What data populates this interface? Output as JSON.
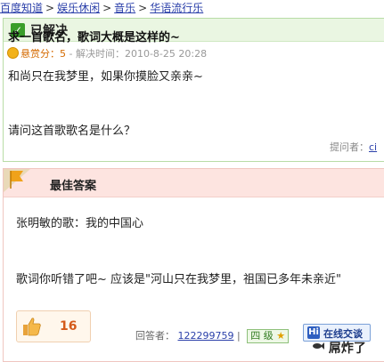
{
  "breadcrumb": {
    "items": [
      "百度知道",
      "娱乐休闲",
      "音乐",
      "华语流行乐"
    ],
    "separator": ">"
  },
  "question": {
    "status": "已解决",
    "title": "求一首歌名，歌词大概是这样的~",
    "bounty_label": "悬赏分：5",
    "resolve_label": "- 解决时间：2010-8-25 20:28",
    "body_line1": "和尚只在我梦里，如果你摸脸又亲亲~",
    "body_line2": "请问这首歌歌名是什么？",
    "asker_label": "提问者：",
    "asker_name": "ci"
  },
  "answer": {
    "header": "最佳答案",
    "line1": "张明敏的歌：我的中国心",
    "line2": "歌词你听错了吧~  应该是\"河山只在我梦里，祖国已多年未亲近\"",
    "likes": "16",
    "answerer_label": "回答者：",
    "answerer_name": "122299759",
    "level_sep": "|",
    "level": "四 级",
    "chat_icon": "Hi",
    "chat_label": "在线交谈"
  },
  "watermark": "屌炸了",
  "colors": {
    "link": "#2a3fa9",
    "question_border": "#b8dca6",
    "answer_header_bg": "#fde4e0",
    "accent_orange": "#d45a1a"
  },
  "icons": {
    "status": "checkmark-icon",
    "bounty": "coin-icon",
    "best": "flag-icon",
    "like": "thumbs-up-icon",
    "chat": "baidu-hi-icon",
    "level": "star-icon"
  }
}
